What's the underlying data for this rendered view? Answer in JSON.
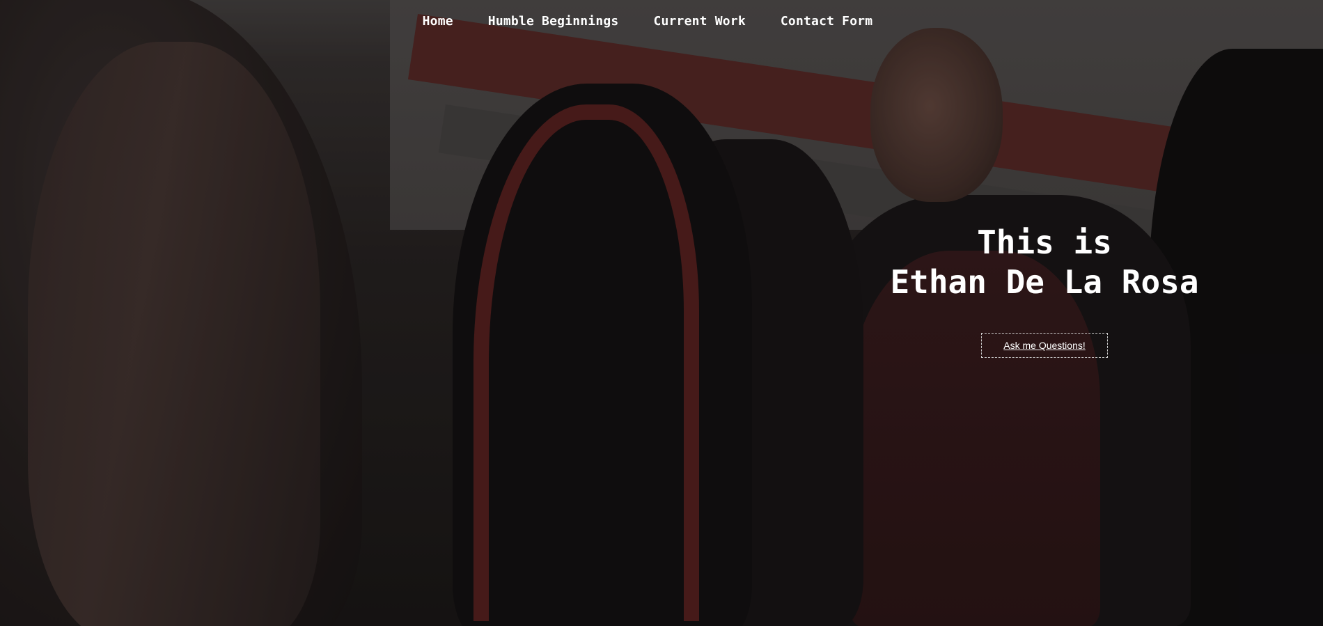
{
  "nav": {
    "items": [
      {
        "label": "Home"
      },
      {
        "label": "Humble Beginnings"
      },
      {
        "label": "Current Work"
      },
      {
        "label": "Contact Form"
      }
    ]
  },
  "hero": {
    "line1": "This is",
    "line2": "Ethan De La Rosa",
    "cta_label": "Ask me Questions!"
  }
}
